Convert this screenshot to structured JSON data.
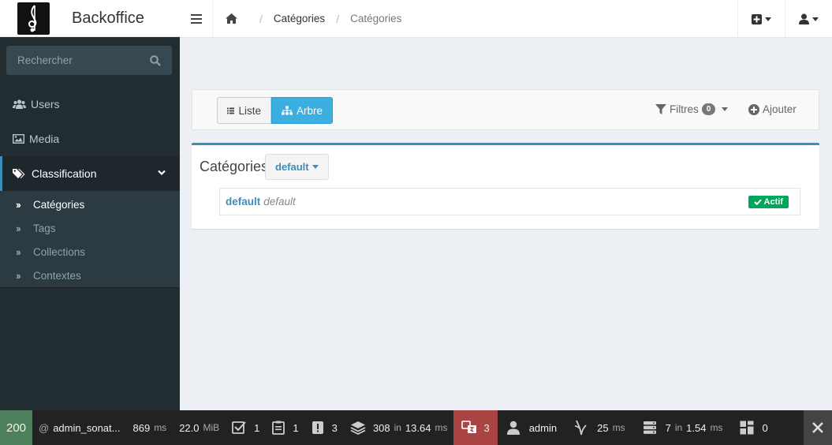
{
  "app": {
    "name": "Backoffice"
  },
  "breadcrumb": {
    "level1": "Catégories",
    "level2": "Catégories"
  },
  "sidebar": {
    "search_placeholder": "Rechercher",
    "items": [
      {
        "label": "Users",
        "icon": "users-icon"
      },
      {
        "label": "Media",
        "icon": "image-icon"
      },
      {
        "label": "Classification",
        "icon": "tags-icon"
      }
    ],
    "subitems": [
      "Catégories",
      "Tags",
      "Collections",
      "Contextes"
    ]
  },
  "toolbar": {
    "list_label": "Liste",
    "tree_label": "Arbre",
    "filters_label": "Filtres",
    "filters_count": "0",
    "add_label": "Ajouter"
  },
  "main": {
    "title": "Catégories",
    "context_select": "default",
    "tree": [
      {
        "name": "default",
        "context": "default",
        "status": "Actif"
      }
    ]
  },
  "debugbar": {
    "status_code": "200",
    "route": "admin_sonat...",
    "time": "869",
    "time_unit": "ms",
    "memory": "22.0",
    "memory_unit": "MiB",
    "forms": "1",
    "validator": "1",
    "logs": "3",
    "doctrine_queries": "308",
    "doctrine_in": "in",
    "doctrine_time": "13.64",
    "doctrine_unit": "ms",
    "translations": "3",
    "user": "admin",
    "twig_time": "25",
    "twig_unit": "ms",
    "cache_calls": "7",
    "cache_in": "in",
    "cache_time": "1.54",
    "cache_unit": "ms",
    "blocks": "0"
  },
  "colors": {
    "accent": "#3c8dbc",
    "sidebar_bg": "#222d32",
    "success": "#00a65a",
    "tree_button": "#3daee0",
    "debug_ok": "#4f805d",
    "debug_warning": "#a94442"
  }
}
